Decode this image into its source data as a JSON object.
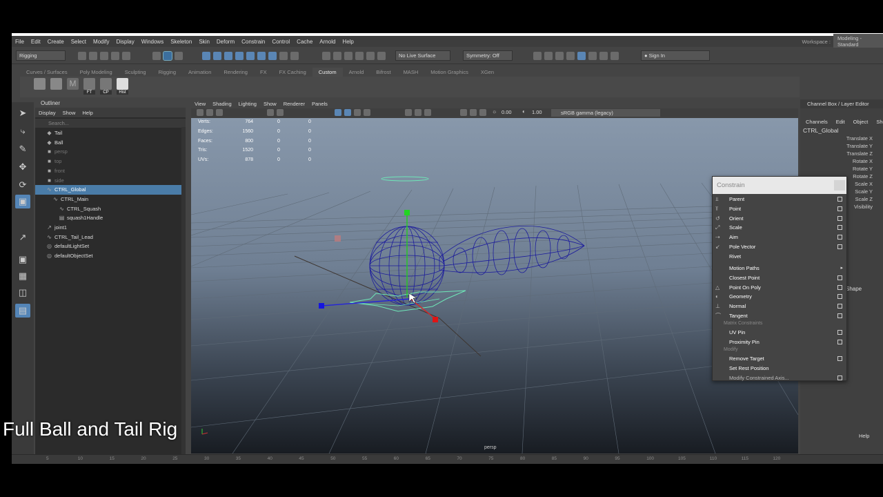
{
  "menubar": [
    "File",
    "Edit",
    "Create",
    "Select",
    "Modify",
    "Display",
    "Windows",
    "Skeleton",
    "Skin",
    "Deform",
    "Constrain",
    "Control",
    "Cache",
    "Arnold",
    "Help"
  ],
  "workspace": {
    "label": "Workspace :",
    "value": "Modeling - Standard"
  },
  "status": {
    "menuset": "Rigging",
    "live_surface": "No Live Surface",
    "symmetry": "Symmetry: Off",
    "sign_in": "Sign In"
  },
  "shelf_tabs": [
    "Curves / Surfaces",
    "Poly Modeling",
    "Sculpting",
    "Rigging",
    "Animation",
    "Rendering",
    "FX",
    "FX Caching",
    "Custom",
    "Arnold",
    "Bifrost",
    "MASH",
    "Motion Graphics",
    "XGen"
  ],
  "shelf_active": "Custom",
  "shelf_labels": [
    "FT",
    "CP",
    "Hist"
  ],
  "outliner": {
    "title": "Outliner",
    "menu": [
      "Display",
      "Show",
      "Help"
    ],
    "search_placeholder": "Search...",
    "rows": [
      {
        "label": "Tail",
        "icon": "transform-icon",
        "state": "normal",
        "indent": 1
      },
      {
        "label": "Ball",
        "icon": "transform-icon",
        "state": "normal",
        "indent": 1
      },
      {
        "label": "persp",
        "icon": "camera-icon",
        "state": "dim",
        "indent": 1
      },
      {
        "label": "top",
        "icon": "camera-icon",
        "state": "dim",
        "indent": 1
      },
      {
        "label": "front",
        "icon": "camera-icon",
        "state": "dim",
        "indent": 1
      },
      {
        "label": "side",
        "icon": "camera-icon",
        "state": "dim",
        "indent": 1
      },
      {
        "label": "CTRL_Global",
        "icon": "curve-icon",
        "state": "selected",
        "indent": 1
      },
      {
        "label": "CTRL_Main",
        "icon": "curve-icon",
        "state": "normal",
        "indent": 2
      },
      {
        "label": "CTRL_Squash",
        "icon": "curve-icon",
        "state": "normal",
        "indent": 3
      },
      {
        "label": "squash1Handle",
        "icon": "deformer-icon",
        "state": "normal",
        "indent": 3
      },
      {
        "label": "joint1",
        "icon": "joint-icon",
        "state": "normal",
        "indent": 1
      },
      {
        "label": "CTRL_Tail_Lead",
        "icon": "curve-icon",
        "state": "normal",
        "indent": 1
      },
      {
        "label": "defaultLightSet",
        "icon": "set-icon",
        "state": "normal",
        "indent": 1
      },
      {
        "label": "defaultObjectSet",
        "icon": "set-icon",
        "state": "normal",
        "indent": 1
      }
    ]
  },
  "viewport": {
    "menu": [
      "View",
      "Shading",
      "Lighting",
      "Show",
      "Renderer",
      "Panels"
    ],
    "exposure": "0.00",
    "gamma": "1.00",
    "colorspace": "sRGB gamma (legacy)",
    "camera": "persp",
    "hud": [
      {
        "label": "Verts:",
        "a": "764",
        "b": "0",
        "c": "0"
      },
      {
        "label": "Edges:",
        "a": "1560",
        "b": "0",
        "c": "0"
      },
      {
        "label": "Faces:",
        "a": "800",
        "b": "0",
        "c": "0"
      },
      {
        "label": "Tris:",
        "a": "1520",
        "b": "0",
        "c": "0"
      },
      {
        "label": "UVs:",
        "a": "878",
        "b": "0",
        "c": "0"
      }
    ]
  },
  "channel_box": {
    "title": "Channel Box / Layer Editor",
    "menu": [
      "Channels",
      "Edit",
      "Object",
      "Show"
    ],
    "node": "CTRL_Global",
    "attributes": [
      "Translate X",
      "Translate Y",
      "Translate Z",
      "Rotate X",
      "Rotate Y",
      "Rotate Z",
      "Scale X",
      "Scale Y",
      "Scale Z",
      "Visibility"
    ],
    "shape_label": "Shape",
    "help": "Help"
  },
  "constrain_menu": {
    "title": "Constrain",
    "items": [
      {
        "label": "Parent",
        "box": true,
        "icon": "parent-constraint-icon"
      },
      {
        "label": "Point",
        "box": true,
        "icon": "point-constraint-icon"
      },
      {
        "label": "Orient",
        "box": true,
        "icon": "orient-constraint-icon"
      },
      {
        "label": "Scale",
        "box": true,
        "icon": "scale-constraint-icon"
      },
      {
        "label": "Aim",
        "box": true,
        "icon": "aim-constraint-icon"
      },
      {
        "label": "Pole Vector",
        "box": true,
        "icon": "pole-vector-icon"
      },
      {
        "label": "Rivet",
        "box": false,
        "icon": ""
      },
      {
        "label": "Motion Paths",
        "box": false,
        "arrow": true,
        "icon": ""
      },
      {
        "label": "Closest Point",
        "box": true,
        "icon": ""
      },
      {
        "label": "Point On Poly",
        "box": true,
        "icon": "point-on-poly-icon"
      },
      {
        "label": "Geometry",
        "box": true,
        "icon": "geometry-constraint-icon"
      },
      {
        "label": "Normal",
        "box": true,
        "icon": "normal-constraint-icon"
      },
      {
        "label": "Tangent",
        "box": true,
        "icon": "tangent-constraint-icon"
      }
    ],
    "section_matrix": "Matrix Constraints",
    "matrix_items": [
      {
        "label": "UV Pin",
        "box": true
      },
      {
        "label": "Proximity Pin",
        "box": true
      }
    ],
    "section_modify": "Modify",
    "modify_items": [
      {
        "label": "Remove Target",
        "box": true,
        "disabled": false
      },
      {
        "label": "Set Rest Position",
        "box": false,
        "disabled": false
      },
      {
        "label": "Modify Constrained Axis...",
        "box": true,
        "disabled": true
      }
    ]
  },
  "timeline_ticks": [
    "5",
    "10",
    "15",
    "20",
    "25",
    "30",
    "35",
    "40",
    "45",
    "50",
    "55",
    "60",
    "65",
    "70",
    "75",
    "80",
    "85",
    "90",
    "95",
    "100",
    "105",
    "110",
    "115",
    "120"
  ],
  "caption": "Full Ball and Tail Rig",
  "colors": {
    "selection": "#4a7ca8",
    "wire": "#1c1c9c",
    "accent_green": "#6ee8b8"
  }
}
